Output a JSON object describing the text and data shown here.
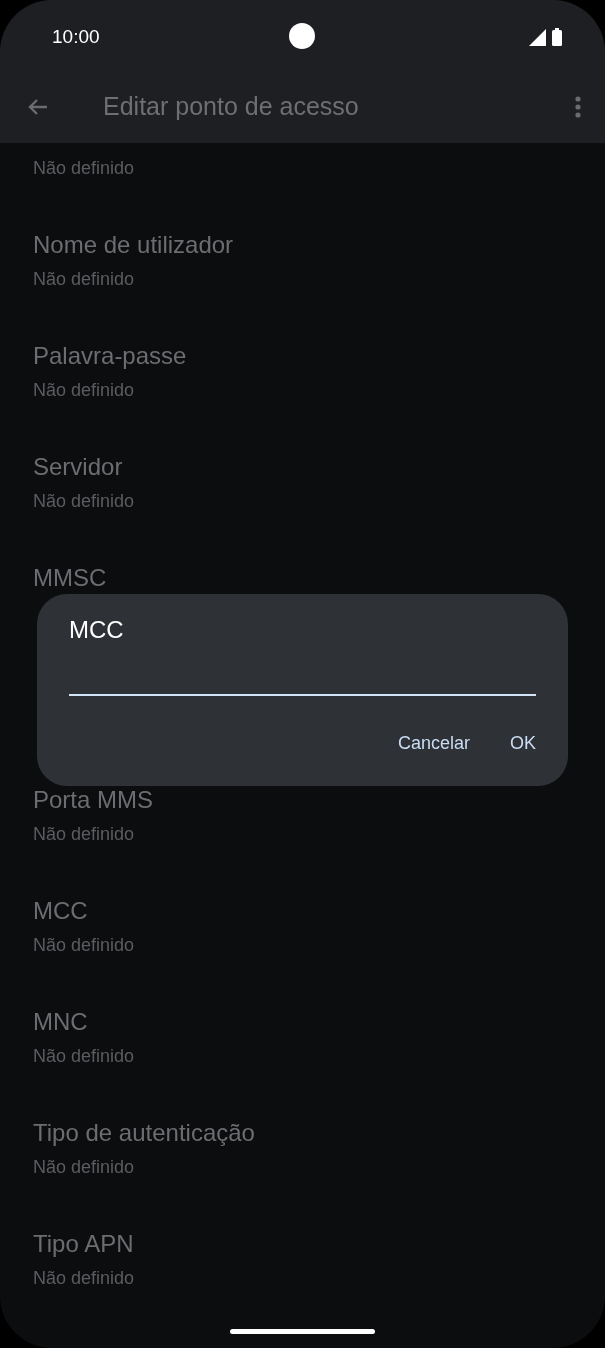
{
  "status_bar": {
    "time": "10:00"
  },
  "app_bar": {
    "title": "Editar ponto de acesso"
  },
  "items": [
    {
      "subtitle": "Não definido"
    },
    {
      "title": "Nome de utilizador",
      "subtitle": "Não definido"
    },
    {
      "title": "Palavra-passe",
      "subtitle": "Não definido"
    },
    {
      "title": "Servidor",
      "subtitle": "Não definido"
    },
    {
      "title": "MMSC"
    },
    {
      "title": "Porta MMS",
      "subtitle": "Não definido"
    },
    {
      "title": "MCC",
      "subtitle": "Não definido"
    },
    {
      "title": "MNC",
      "subtitle": "Não definido"
    },
    {
      "title": "Tipo de autenticação",
      "subtitle": "Não definido"
    },
    {
      "title": "Tipo APN",
      "subtitle": "Não definido"
    }
  ],
  "dialog": {
    "title": "MCC",
    "buttons": [
      "Cancelar",
      "OK"
    ]
  }
}
